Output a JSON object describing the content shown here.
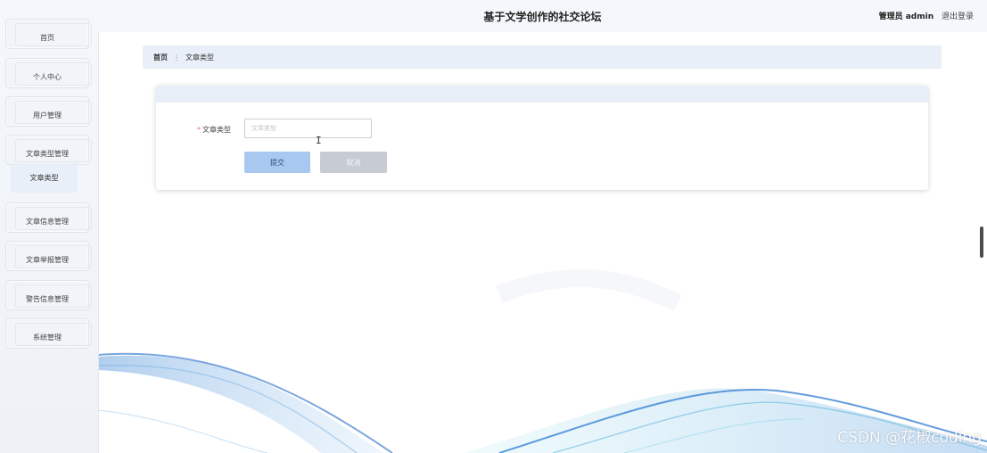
{
  "header": {
    "title": "基于文学创作的社交论坛",
    "role": "管理员 admin",
    "logout": "退出登录"
  },
  "sidebar": {
    "items": [
      {
        "label": "首页"
      },
      {
        "label": "个人中心"
      },
      {
        "label": "用户管理"
      },
      {
        "label": "文章类型管理"
      },
      {
        "label": "文章信息管理"
      },
      {
        "label": "文章举报管理"
      },
      {
        "label": "警告信息管理"
      },
      {
        "label": "系统管理"
      }
    ],
    "subitem": "文章类型"
  },
  "breadcrumb": {
    "home": "首页",
    "current": "文章类型"
  },
  "form": {
    "field_label": "文章类型",
    "required_mark": "*",
    "field_placeholder": "文章类型",
    "field_value": "",
    "submit_label": "提交",
    "cancel_label": "取消"
  },
  "text_cursor": "I",
  "watermark": "CSDN @花椒coding",
  "colors": {
    "accent": "#a9c8f0",
    "header_bg": "#f4f7fb",
    "required": "#f56c6c"
  }
}
